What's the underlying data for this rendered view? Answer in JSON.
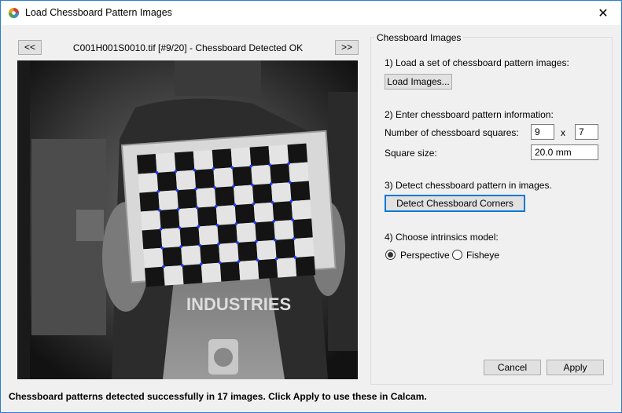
{
  "window": {
    "title": "Load Chessboard Pattern Images",
    "close_glyph": "✕"
  },
  "viewer": {
    "prev_label": "<<",
    "next_label": ">>",
    "image_caption": "C001H001S0010.tif [#9/20] - Chessboard Detected OK"
  },
  "panel": {
    "group_title": "Chessboard Images",
    "step1": "1) Load a set of chessboard pattern images:",
    "load_button": "Load Images...",
    "step2": "2) Enter chessboard pattern information:",
    "squares_label": "Number of chessboard squares:",
    "squares_x": "9",
    "squares_sep": "x",
    "squares_y": "7",
    "size_label": "Square size:",
    "size_value": "20.0 mm",
    "step3": "3) Detect chessboard pattern in images.",
    "detect_button": "Detect Chessboard Corners",
    "step4": "4) Choose intrinsics model:",
    "model_perspective": "Perspective",
    "model_fisheye": "Fisheye",
    "model_selected": "Perspective"
  },
  "footer": {
    "cancel_label": "Cancel",
    "apply_label": "Apply",
    "status": "Chessboard patterns detected successfully in 17 images. Click Apply to use these in Calcam."
  },
  "colors": {
    "accent": "#0078d7",
    "corner_marker": "#1a3cff"
  }
}
